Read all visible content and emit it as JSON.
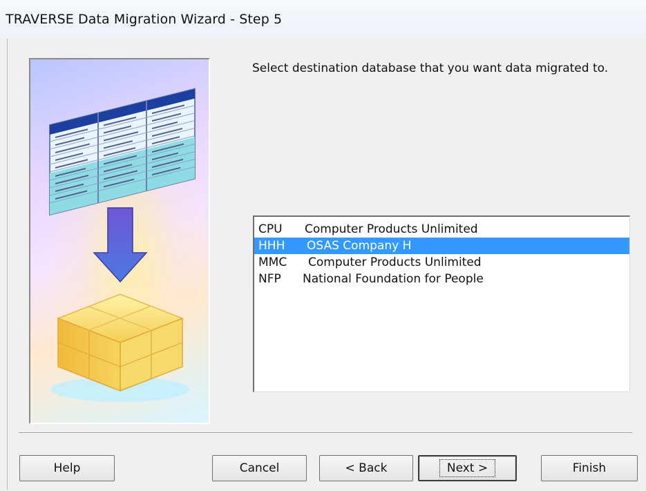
{
  "window": {
    "title": "TRAVERSE Data Migration Wizard - Step 5"
  },
  "instruction": "Select destination database that you want data migrated to.",
  "databases": [
    {
      "code": "CPU",
      "name": "Computer Products Unlimited",
      "selected": false
    },
    {
      "code": "HHH",
      "name": "OSAS Company H",
      "selected": true
    },
    {
      "code": "MMC",
      "name": "Computer Products Unlimited",
      "selected": false
    },
    {
      "code": "NFP",
      "name": "National Foundation for People",
      "selected": false
    }
  ],
  "buttons": {
    "help": "Help",
    "cancel": "Cancel",
    "back": "< Back",
    "next": "Next >",
    "finish": "Finish"
  },
  "colors": {
    "selection": "#3399ff",
    "dialog_background": "#f0f0f0"
  },
  "icons": {
    "wizard_image": "database-migration-illustration"
  }
}
